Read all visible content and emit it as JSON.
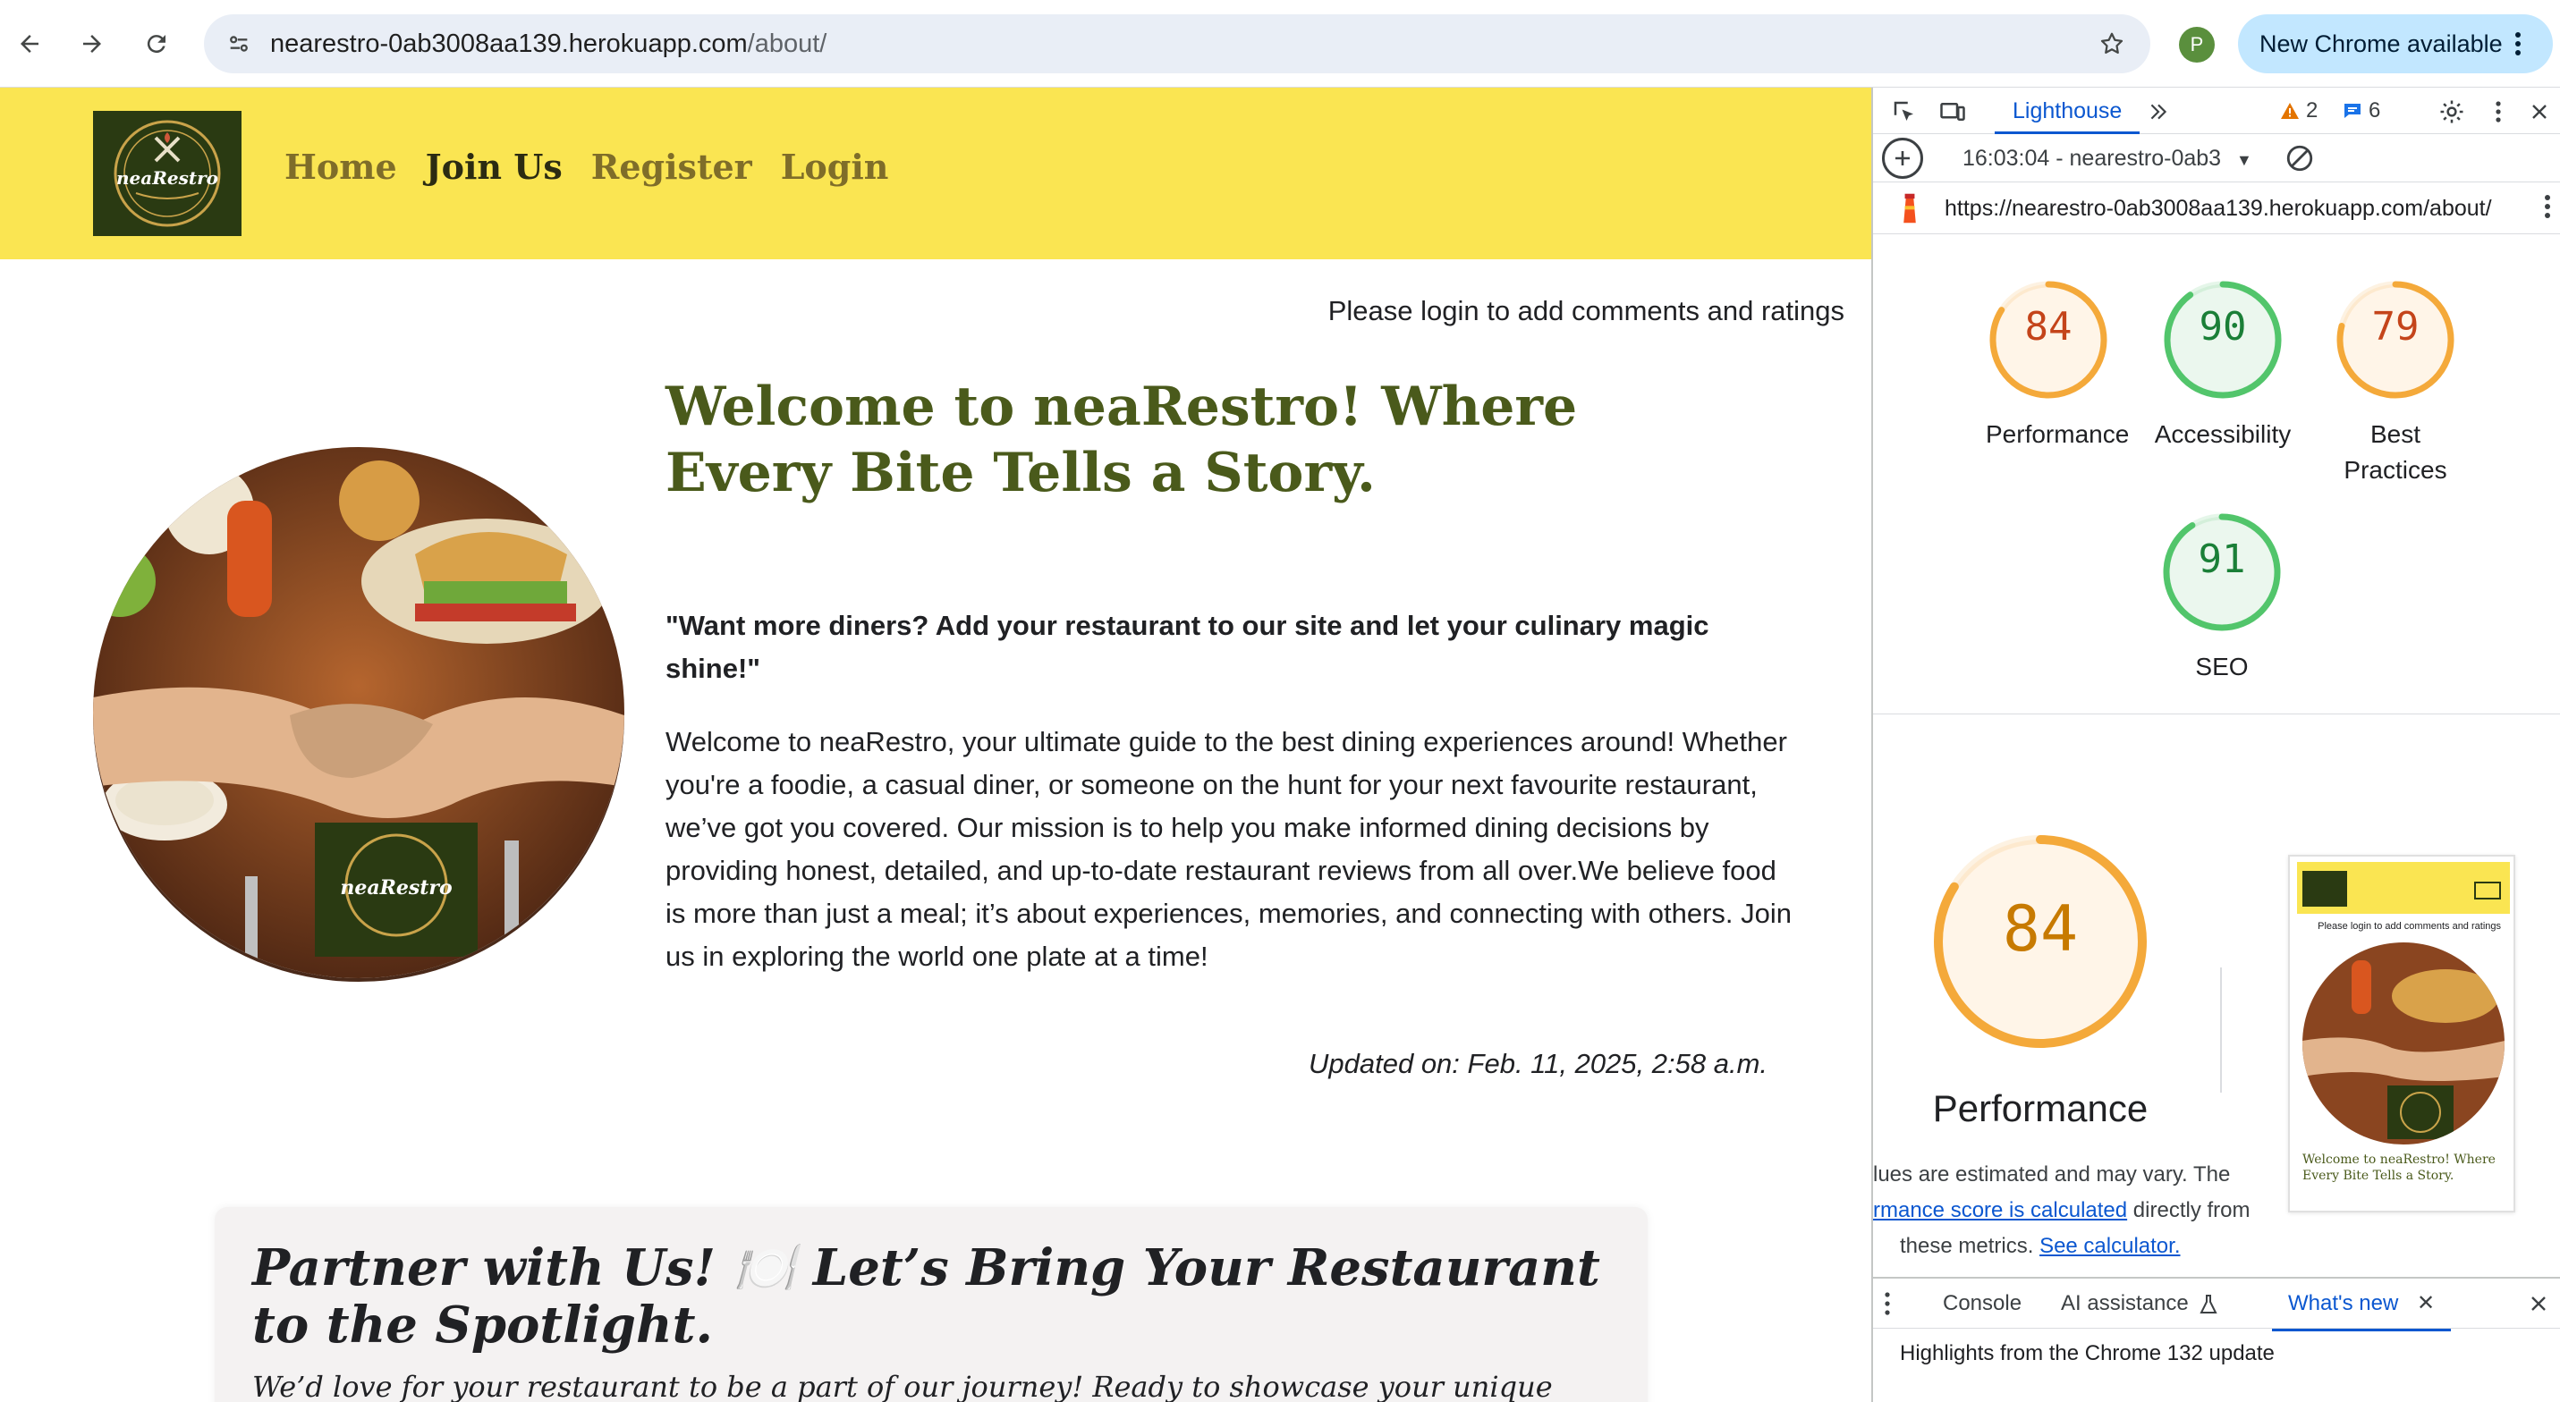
{
  "browser": {
    "url_host": "nearestro-0ab3008aa139.herokuapp.com",
    "url_path": "/about/",
    "profile_initial": "P",
    "update_label": "New Chrome available"
  },
  "site": {
    "logo_text": "neaRestro",
    "nav": [
      "Home",
      "Join Us",
      "Register",
      "Login"
    ],
    "active_nav": "Join Us",
    "login_note": "Please login to add comments and ratings",
    "welcome_title": "Welcome to neaRestro! Where Every Bite Tells a Story.",
    "quote": "\"Want more diners? Add your restaurant to our site and let your culinary magic shine!\"",
    "about": "Welcome to neaRestro, your ultimate guide to the best dining experiences around! Whether you're a foodie, a casual diner, or someone on the hunt for your next favourite restaurant, we’ve got you covered. Our mission is to help you make informed dining decisions by providing honest, detailed, and up-to-date restaurant reviews from all over.We believe food is more than just a meal; it’s about experiences, memories, and connecting with others. Join us in exploring the world one plate at a time!",
    "updated": "Updated on: Feb. 11, 2025, 2:58 a.m.",
    "partner_title": "Partner with Us! 🍽️ Let’s Bring Your Restaurant to the Spotlight.",
    "partner_sub": "We’d love for your restaurant to be a part of our journey! Ready to showcase your unique"
  },
  "devtools": {
    "tab_lighthouse": "Lighthouse",
    "warnings": "2",
    "messages": "6",
    "report_select": "16:03:04 - nearestro-0ab3",
    "report_url": "https://nearestro-0ab3008aa139.herokuapp.com/about/",
    "scores": [
      {
        "label": "Performance",
        "value": 84,
        "color": "#f4a93a",
        "text": "#c4441a"
      },
      {
        "label": "Accessibility",
        "value": 90,
        "color": "#52c56b",
        "text": "#1a7f37"
      },
      {
        "label": "Best Practices",
        "value": 79,
        "color": "#f4a93a",
        "text": "#c4441a"
      },
      {
        "label": "SEO",
        "value": 91,
        "color": "#52c56b",
        "text": "#1a7f37"
      }
    ],
    "big_score": 84,
    "big_label": "Performance",
    "desc_part1": "lues are estimated and may vary. The",
    "desc_link1": "rmance score is calculated",
    "desc_part2": " directly from",
    "desc_part3": "these metrics.",
    "desc_link2": "See calculator.",
    "thumb_note": "Please login to add comments and ratings",
    "thumb_title": "Welcome to neaRestro! Where Every Bite Tells a Story.",
    "drawer_tabs": [
      "Console",
      "AI assistance",
      "What's new"
    ],
    "drawer_content": "Highlights from the Chrome 132 update"
  }
}
